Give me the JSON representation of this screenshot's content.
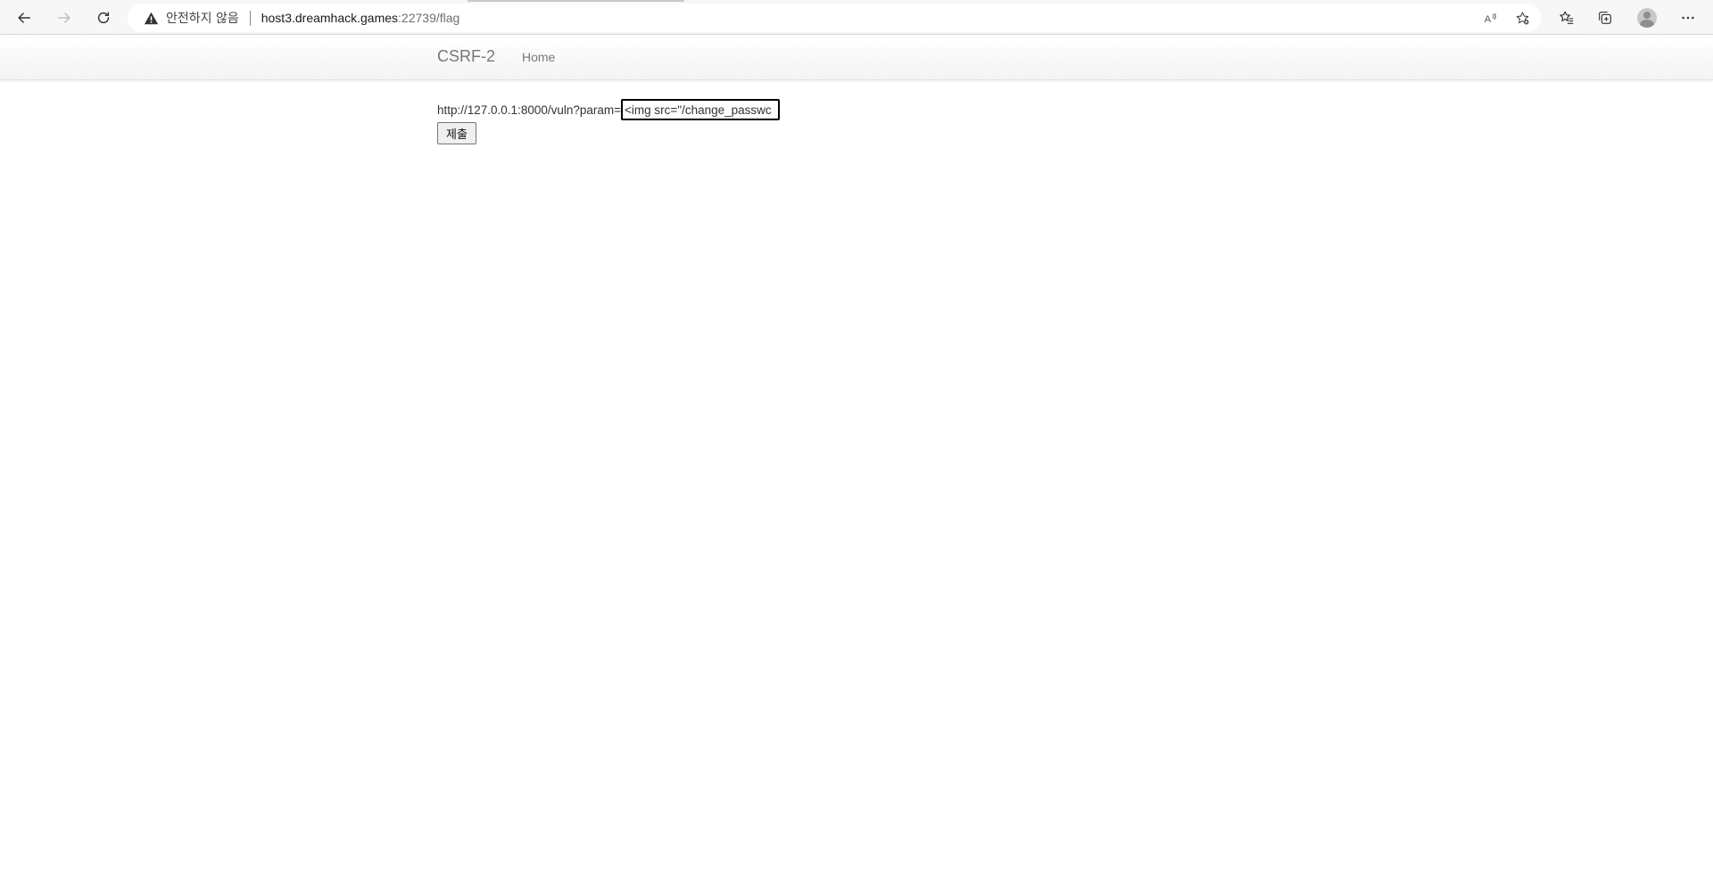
{
  "browser": {
    "security_label": "안전하지 않음",
    "url_host": "host3.dreamhack.games",
    "url_rest": ":22739/flag"
  },
  "navbar": {
    "brand": "CSRF-2",
    "home_label": "Home"
  },
  "form": {
    "label": "http://127.0.0.1:8000/vuln?param=",
    "input_value": "<img src=\"/change_passwc",
    "submit_label": "제출"
  }
}
